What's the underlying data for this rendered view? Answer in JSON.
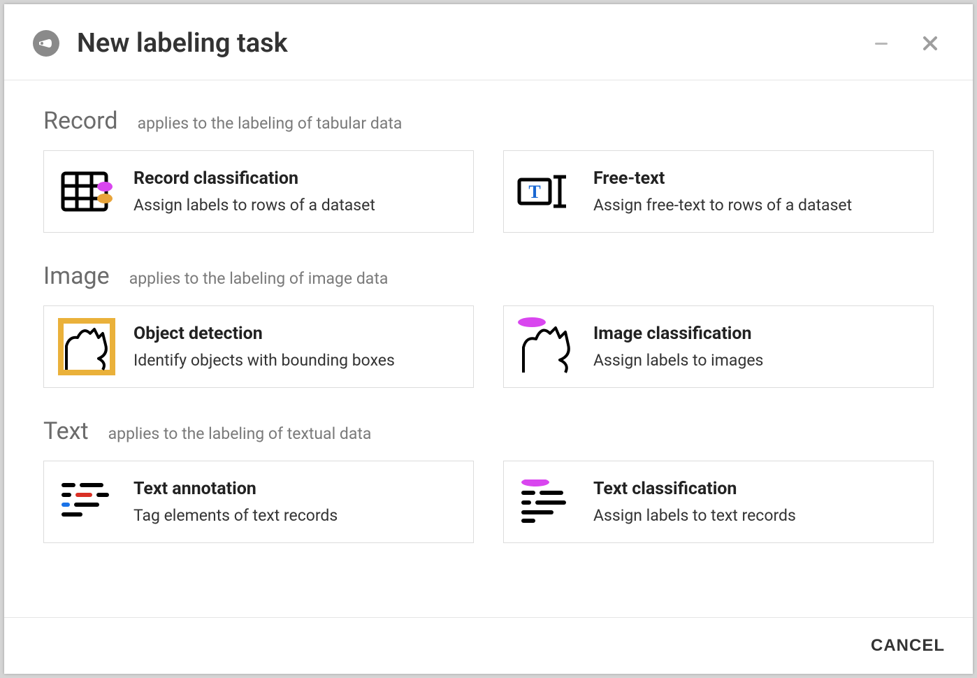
{
  "header": {
    "title": "New labeling task"
  },
  "sections": {
    "record": {
      "title": "Record",
      "subtitle": "applies to the labeling of tabular data",
      "cards": [
        {
          "title": "Record classification",
          "desc": "Assign labels to rows of a dataset"
        },
        {
          "title": "Free-text",
          "desc": "Assign free-text to rows of a dataset"
        }
      ]
    },
    "image": {
      "title": "Image",
      "subtitle": "applies to the labeling of image data",
      "cards": [
        {
          "title": "Object detection",
          "desc": "Identify objects with bounding boxes"
        },
        {
          "title": "Image classification",
          "desc": "Assign labels to images"
        }
      ]
    },
    "text": {
      "title": "Text",
      "subtitle": "applies to the labeling of textual data",
      "cards": [
        {
          "title": "Text annotation",
          "desc": "Tag elements of text records"
        },
        {
          "title": "Text classification",
          "desc": "Assign labels to text records"
        }
      ]
    }
  },
  "footer": {
    "cancel": "CANCEL"
  }
}
